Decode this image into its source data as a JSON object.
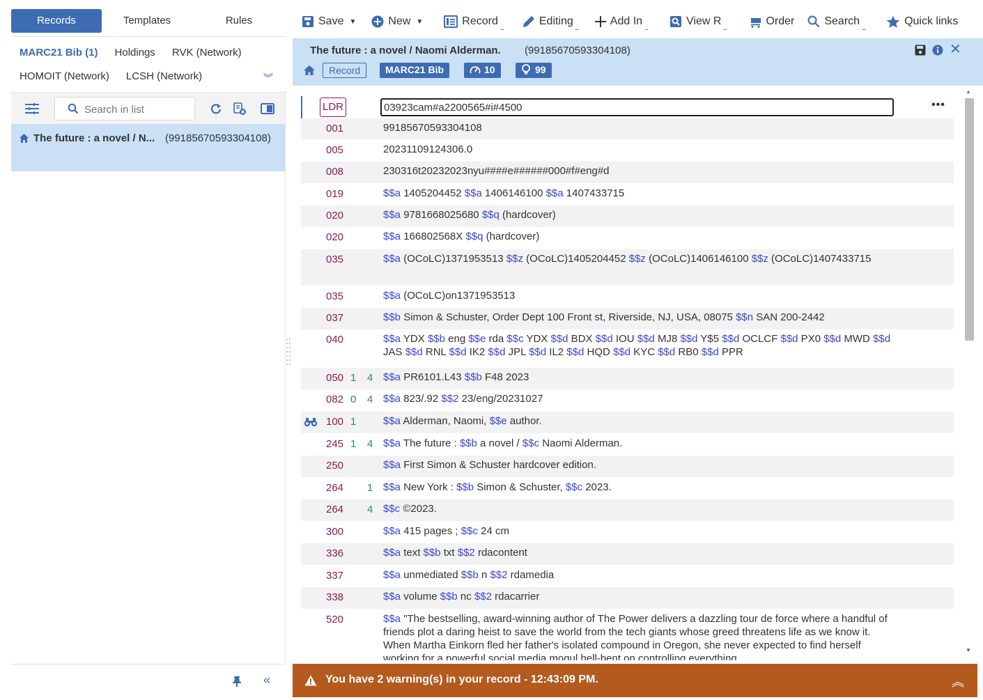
{
  "nav_tabs": [
    "Records",
    "Templates",
    "Rules"
  ],
  "category_tabs": {
    "row1": [
      "MARC21 Bib (1)",
      "Holdings",
      "RVK (Network)"
    ],
    "row2": [
      "HOMOIT (Network)",
      "LCSH (Network)"
    ]
  },
  "search": {
    "placeholder": "Search in list"
  },
  "list_item": {
    "title": "The future : a novel / N...",
    "mms_id": "(99185670593304108)"
  },
  "toolbar": {
    "save": "Save",
    "new": "New",
    "record": "Record",
    "editing": "Editing",
    "add_in": "Add In",
    "view_r": "View R",
    "order": "Order",
    "search": "Search",
    "quick_links": "Quick links"
  },
  "record_header": {
    "title": "The future : a novel / Naomi Alderman.",
    "mms_id": "(99185670593304108)",
    "record_badge": "Record",
    "bib_badge": "MARC21 Bib",
    "score": "10",
    "views": "99"
  },
  "marc": {
    "ldr_label": "LDR",
    "ldr_value": "03923cam#a2200565#i#4500",
    "fields": [
      {
        "tag": "001",
        "ind1": "",
        "ind2": "",
        "parts": [
          [
            "",
            "99185670593304108"
          ]
        ]
      },
      {
        "tag": "005",
        "ind1": "",
        "ind2": "",
        "parts": [
          [
            "",
            "20231109124306.0"
          ]
        ]
      },
      {
        "tag": "008",
        "ind1": "",
        "ind2": "",
        "parts": [
          [
            "",
            "230316t20232023nyu####e######000#f#eng#d"
          ]
        ]
      },
      {
        "tag": "019",
        "ind1": "",
        "ind2": "",
        "parts": [
          [
            "$$a",
            " 1405204452 "
          ],
          [
            "$$a",
            " 1406146100 "
          ],
          [
            "$$a",
            " 1407433715"
          ]
        ]
      },
      {
        "tag": "020",
        "ind1": "",
        "ind2": "",
        "parts": [
          [
            "$$a",
            " 9781668025680 "
          ],
          [
            "$$q",
            " (hardcover)"
          ]
        ]
      },
      {
        "tag": "020",
        "ind1": "",
        "ind2": "",
        "parts": [
          [
            "$$a",
            " 166802568X "
          ],
          [
            "$$q",
            " (hardcover)"
          ]
        ]
      },
      {
        "tag": "035",
        "ind1": "",
        "ind2": "",
        "parts": [
          [
            "$$a",
            " (OCoLC)1371953513 "
          ],
          [
            "$$z",
            " (OCoLC)1405204452 "
          ],
          [
            "$$z",
            " (OCoLC)1406146100 "
          ],
          [
            "$$z",
            " (OCoLC)1407433715"
          ]
        ]
      },
      {
        "tag": "035",
        "ind1": "",
        "ind2": "",
        "parts": [
          [
            "$$a",
            " (OCoLC)on1371953513"
          ]
        ]
      },
      {
        "tag": "037",
        "ind1": "",
        "ind2": "",
        "parts": [
          [
            "$$b",
            " Simon & Schuster, Order Dept 100 Front st, Riverside, NJ, USA, 08075 "
          ],
          [
            "$$n",
            " SAN 200-2442"
          ]
        ]
      },
      {
        "tag": "040",
        "ind1": "",
        "ind2": "",
        "parts": [
          [
            "$$a",
            " YDX "
          ],
          [
            "$$b",
            " eng "
          ],
          [
            "$$e",
            " rda "
          ],
          [
            "$$c",
            " YDX "
          ],
          [
            "$$d",
            " BDX "
          ],
          [
            "$$d",
            " IOU "
          ],
          [
            "$$d",
            " MJ8 "
          ],
          [
            "$$d",
            " Y$5 "
          ],
          [
            "$$d",
            " OCLCF "
          ],
          [
            "$$d",
            " PX0 "
          ],
          [
            "$$d",
            " MWD "
          ],
          [
            "$$d",
            " JAS "
          ],
          [
            "$$d",
            " RNL "
          ],
          [
            "$$d",
            " IK2 "
          ],
          [
            "$$d",
            " JPL "
          ],
          [
            "$$d",
            " IL2 "
          ],
          [
            "$$d",
            " HQD "
          ],
          [
            "$$d",
            " KYC "
          ],
          [
            "$$d",
            " RB0 "
          ],
          [
            "$$d",
            " PPR"
          ]
        ]
      },
      {
        "tag": "050",
        "ind1": "1",
        "ind2": "4",
        "parts": [
          [
            "$$a",
            " PR6101.L43 "
          ],
          [
            "$$b",
            " F48 2023"
          ]
        ]
      },
      {
        "tag": "082",
        "ind1": "0",
        "ind2": "4",
        "parts": [
          [
            "$$a",
            " 823/.92 "
          ],
          [
            "$$2",
            " 23/eng/20231027"
          ]
        ]
      },
      {
        "tag": "100",
        "ind1": "1",
        "ind2": "",
        "parts": [
          [
            "$$a",
            " Alderman, Naomi, "
          ],
          [
            "$$e",
            " author."
          ]
        ]
      },
      {
        "tag": "245",
        "ind1": "1",
        "ind2": "4",
        "parts": [
          [
            "$$a",
            " The future : "
          ],
          [
            "$$b",
            " a novel / "
          ],
          [
            "$$c",
            " Naomi Alderman."
          ]
        ]
      },
      {
        "tag": "250",
        "ind1": "",
        "ind2": "",
        "parts": [
          [
            "$$a",
            " First Simon & Schuster hardcover edition."
          ]
        ]
      },
      {
        "tag": "264",
        "ind1": "",
        "ind2": "1",
        "parts": [
          [
            "$$a",
            " New York : "
          ],
          [
            "$$b",
            " Simon & Schuster, "
          ],
          [
            "$$c",
            " 2023."
          ]
        ]
      },
      {
        "tag": "264",
        "ind1": "",
        "ind2": "4",
        "parts": [
          [
            "$$c",
            " ©2023."
          ]
        ]
      },
      {
        "tag": "300",
        "ind1": "",
        "ind2": "",
        "parts": [
          [
            "$$a",
            " 415 pages ; "
          ],
          [
            "$$c",
            " 24 cm"
          ]
        ]
      },
      {
        "tag": "336",
        "ind1": "",
        "ind2": "",
        "parts": [
          [
            "$$a",
            " text "
          ],
          [
            "$$b",
            " txt "
          ],
          [
            "$$2",
            " rdacontent"
          ]
        ]
      },
      {
        "tag": "337",
        "ind1": "",
        "ind2": "",
        "parts": [
          [
            "$$a",
            " unmediated "
          ],
          [
            "$$b",
            " n "
          ],
          [
            "$$2",
            " rdamedia"
          ]
        ]
      },
      {
        "tag": "338",
        "ind1": "",
        "ind2": "",
        "parts": [
          [
            "$$a",
            " volume "
          ],
          [
            "$$b",
            " nc "
          ],
          [
            "$$2",
            " rdacarrier"
          ]
        ]
      },
      {
        "tag": "520",
        "ind1": "",
        "ind2": "",
        "parts": [
          [
            "$$a",
            " \"The bestselling, award-winning author of The Power delivers a dazzling tour de force where a handful of friends plot a daring heist to save the world from the tech giants whose greed threatens life as we know it. When Martha Einkorn fled her father's isolated compound in Oregon, she never expected to find herself working for a powerful social media mogul hell-bent on controlling everything"
          ]
        ]
      }
    ]
  },
  "warning": {
    "text": "You have 2 warning(s) in your record - 12:43:09 PM."
  },
  "colors": {
    "accent": "#3d6cb5",
    "selection": "#c9e0f5",
    "warning": "#b45a1e",
    "tag": "#8b1a5a",
    "indicator": "#2e8b57",
    "subfield": "#3b46d8"
  }
}
